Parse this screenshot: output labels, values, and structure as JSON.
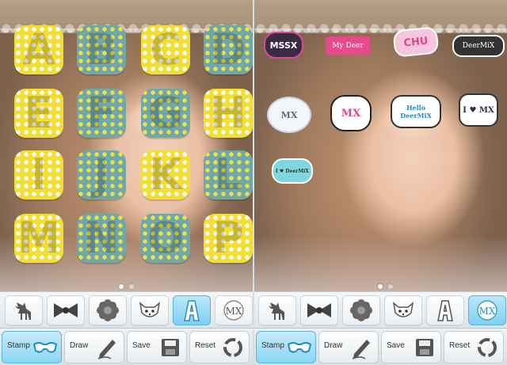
{
  "left_panel": {
    "letters": [
      {
        "char": "A",
        "style": "y"
      },
      {
        "char": "B",
        "style": "b"
      },
      {
        "char": "C",
        "style": "y"
      },
      {
        "char": "D",
        "style": "b"
      },
      {
        "char": "E",
        "style": "y"
      },
      {
        "char": "F",
        "style": "b"
      },
      {
        "char": "G",
        "style": "b"
      },
      {
        "char": "H",
        "style": "y"
      },
      {
        "char": "I",
        "style": "y"
      },
      {
        "char": "J",
        "style": "b"
      },
      {
        "char": "K",
        "style": "y"
      },
      {
        "char": "L",
        "style": "b"
      },
      {
        "char": "M",
        "style": "y"
      },
      {
        "char": "N",
        "style": "b"
      },
      {
        "char": "O",
        "style": "b"
      },
      {
        "char": "P",
        "style": "y"
      }
    ]
  },
  "right_panel": {
    "stickers": [
      {
        "text": "MSSX",
        "kind": "msx-dark"
      },
      {
        "text": "My Deer",
        "kind": "mydeer"
      },
      {
        "text": "CHU",
        "kind": "chu-heart"
      },
      {
        "text": "DeerMiX",
        "kind": "deermix-dark"
      },
      {
        "text": "MX",
        "kind": "cloud-bow"
      },
      {
        "text": "MX",
        "kind": "burst-mx"
      },
      {
        "text": "Hello DeerMiX",
        "kind": "hello-deermix"
      },
      {
        "text": "I ♥ MX",
        "kind": "i-love-mx"
      },
      {
        "text": "I ♥ DeerMiX",
        "kind": "cloud-teal"
      }
    ]
  },
  "toolbar": {
    "icons": [
      {
        "name": "deer-icon"
      },
      {
        "name": "bow-icon"
      },
      {
        "name": "flower-icon"
      },
      {
        "name": "face-icon"
      },
      {
        "name": "letter-a-icon"
      },
      {
        "name": "mx-logo-icon"
      }
    ],
    "left_active_index": 4,
    "right_active_index": 5
  },
  "actions": {
    "stamp": "Stamp",
    "draw": "Draw",
    "save": "Save",
    "reset": "Reset"
  },
  "colors": {
    "accent_blue": "#7fd0f2",
    "dot_yellow": "#f2de35",
    "dot_teal": "#6fa8a8"
  }
}
